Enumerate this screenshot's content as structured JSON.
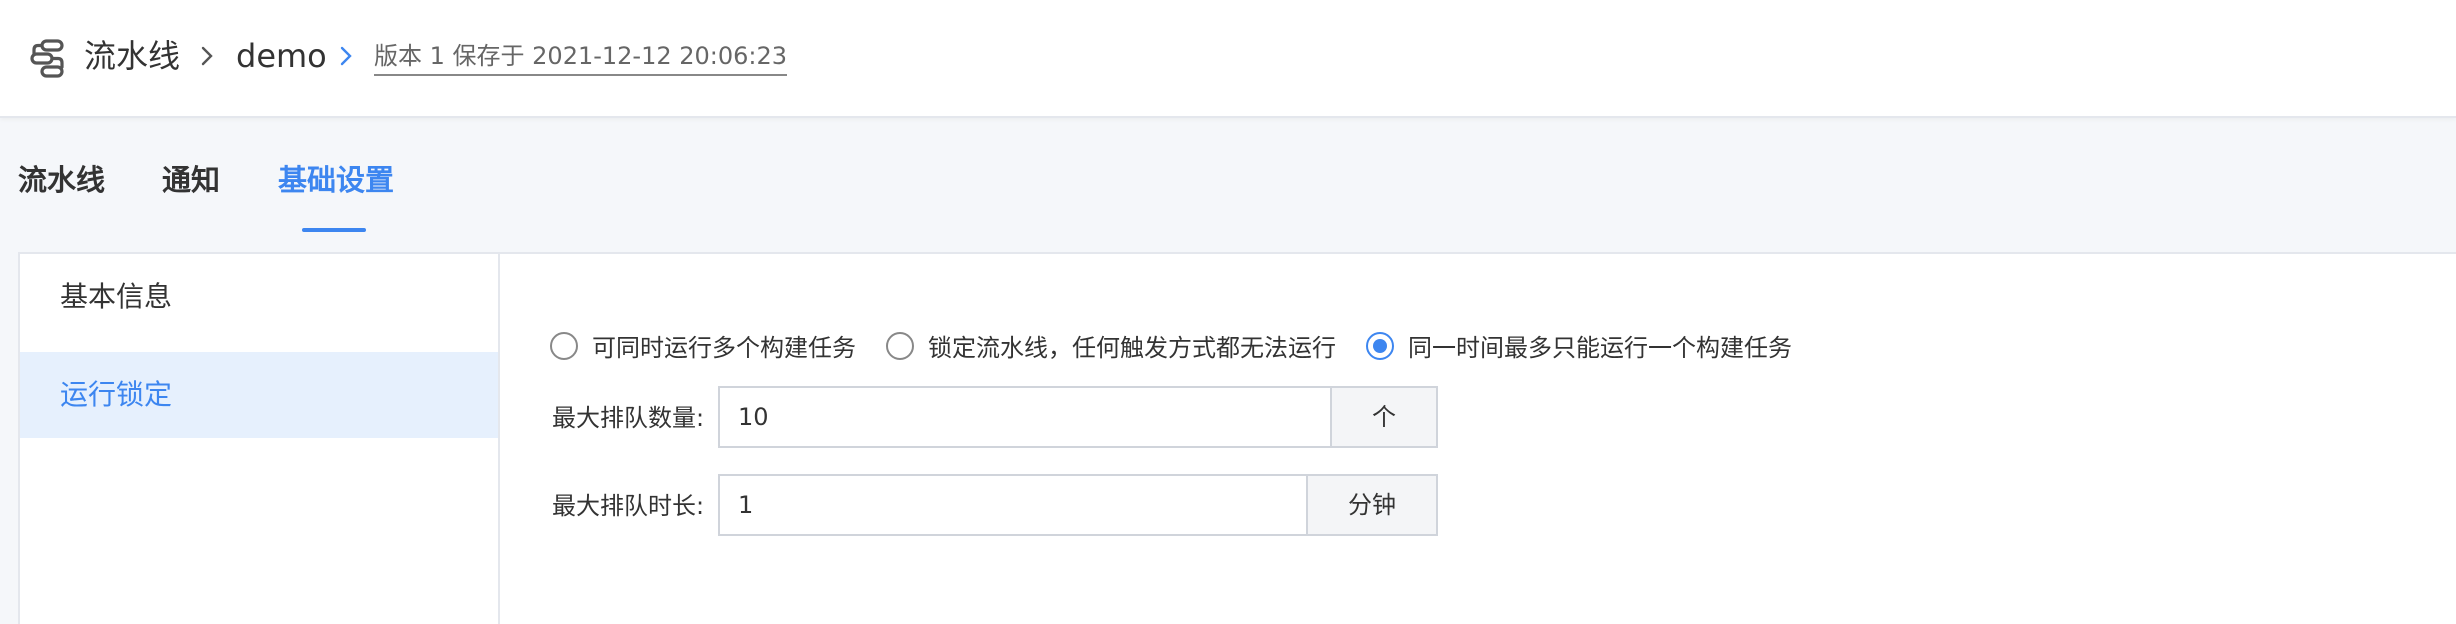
{
  "header": {
    "logo_icon": "pipeline-logo-icon",
    "breadcrumb": [
      {
        "label": "流水线"
      },
      {
        "label": "demo"
      }
    ],
    "version_text": "版本 1 保存于 2021-12-12 20:06:23"
  },
  "tabs": [
    {
      "label": "流水线",
      "active": false
    },
    {
      "label": "通知",
      "active": false
    },
    {
      "label": "基础设置",
      "active": true
    }
  ],
  "sidebar": {
    "items": [
      {
        "label": "基本信息",
        "active": false
      },
      {
        "label": "运行锁定",
        "active": true
      }
    ]
  },
  "run_lock": {
    "options": [
      {
        "label": "可同时运行多个构建任务",
        "selected": false
      },
      {
        "label": "锁定流水线，任何触发方式都无法运行",
        "selected": false
      },
      {
        "label": "同一时间最多只能运行一个构建任务",
        "selected": true
      }
    ],
    "max_queue_count": {
      "label": "最大排队数量:",
      "value": "10",
      "unit": "个"
    },
    "max_queue_time": {
      "label": "最大排队时长:",
      "value": "1",
      "unit": "分钟"
    }
  },
  "colors": {
    "accent": "#3d86f0",
    "active_bg": "#e6f0fd",
    "page_bg": "#f5f7fa"
  }
}
